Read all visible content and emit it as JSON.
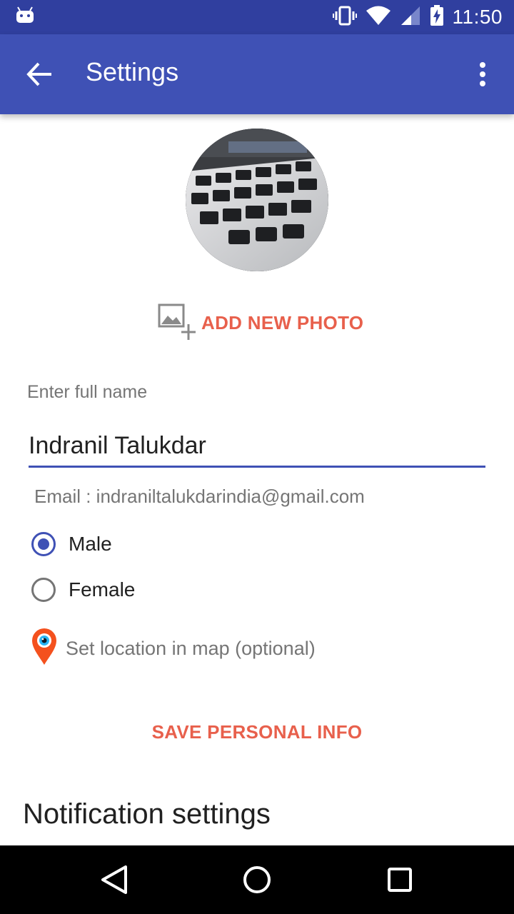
{
  "status_bar": {
    "time": "11:50",
    "icons": [
      "android-icon",
      "vibrate-icon",
      "wifi-icon",
      "signal-icon",
      "battery-charging-icon"
    ]
  },
  "app_bar": {
    "title": "Settings",
    "back_icon": "arrow-back-icon",
    "menu_icon": "more-vert-icon"
  },
  "profile": {
    "add_photo_label": "ADD NEW PHOTO",
    "add_photo_icon": "add-photo-icon"
  },
  "form": {
    "name_label": "Enter full name",
    "name_value": "Indranil Talukdar",
    "email_text": "Email : indraniltalukdarindia@gmail.com",
    "gender_options": [
      {
        "label": "Male",
        "checked": true
      },
      {
        "label": "Female",
        "checked": false
      }
    ],
    "location_label": "Set location in map (optional)",
    "location_icon": "map-pin-icon",
    "save_label": "SAVE PERSONAL INFO"
  },
  "notifications": {
    "section_title": "Notification settings"
  },
  "nav_bar": {
    "buttons": [
      "back-triangle-icon",
      "home-circle-icon",
      "recents-square-icon"
    ]
  },
  "colors": {
    "status_bar": "#303f9f",
    "app_bar": "#3f51b5",
    "accent": "#e8604c",
    "radio_checked": "#3f51b5"
  }
}
